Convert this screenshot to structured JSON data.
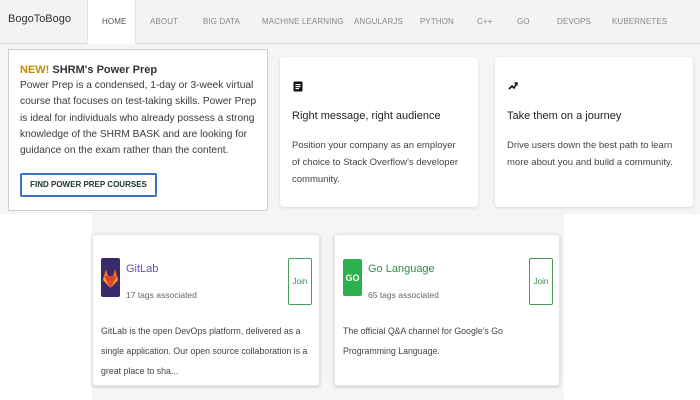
{
  "nav": {
    "brand": "BogoToBogo",
    "items": [
      "HOME",
      "ABOUT",
      "BIG DATA",
      "MACHINE LEARNING",
      "ANGULARJS",
      "PYTHON",
      "C++",
      "GO",
      "DEVOPS",
      "KUBERNETES"
    ],
    "active": "HOME"
  },
  "shrm": {
    "new_label": "NEW!",
    "title": "SHRM's Power Prep",
    "body": "Power Prep is a condensed, 1-day or 3-week virtual course that focuses on test-taking skills. Power Prep is ideal for individuals who already possess a strong knowledge of the SHRM BASK and are looking for guidance on the exam rather than the content.",
    "button": "FIND POWER PREP COURSES"
  },
  "features": [
    {
      "icon": "stack-overflow-icon",
      "title": "Right message, right audience",
      "body": "Position your company as an employer of choice to Stack Overflow's developer community."
    },
    {
      "icon": "trend-icon",
      "title": "Take them on a journey",
      "body": "Drive users down the best path to learn more about you and build a community."
    }
  ],
  "communities": [
    {
      "name": "GitLab",
      "name_color": "#6a4bbf",
      "tags": "17 tags associated",
      "join": "Join",
      "description": "GitLab is the open DevOps platform, delivered as a single application. Our open source collaboration is a great place to sha...",
      "logo": "gitlab-icon"
    },
    {
      "name": "Go Language",
      "name_color": "#2f8f4a",
      "tags": "65 tags associated",
      "join": "Join",
      "description": "The official Q&A channel for Google's Go Programming Language.",
      "logo": "go-icon"
    }
  ],
  "colors": {
    "accent_blue": "#3c72c4",
    "join_green": "#4a9a5a",
    "new_gold": "#c28b00"
  }
}
